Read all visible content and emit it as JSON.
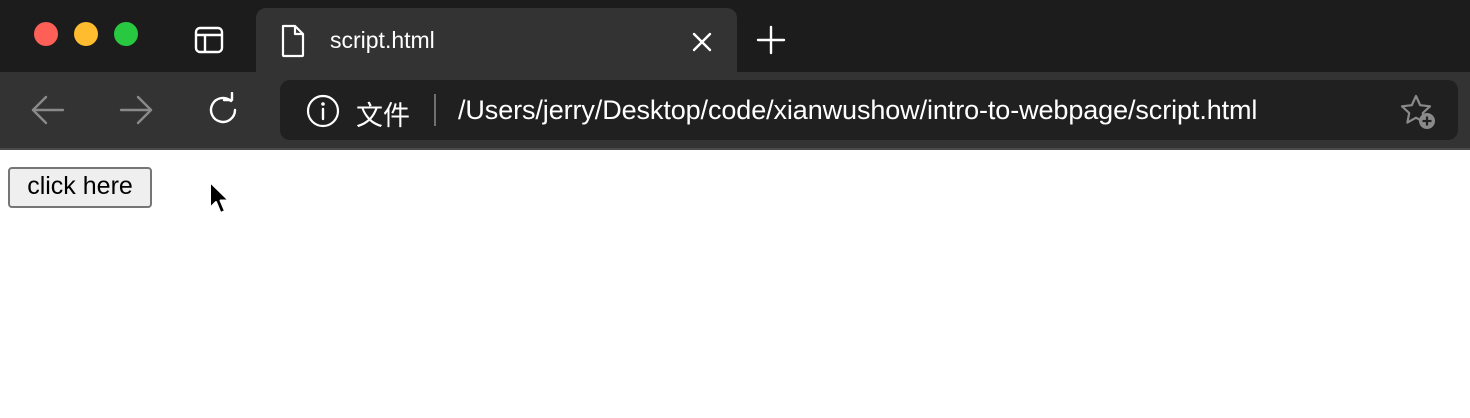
{
  "window": {
    "traffic_lights": {
      "close": {
        "icon": "close-dot",
        "color": "#fe5f57"
      },
      "minimize": {
        "icon": "minimize-dot",
        "color": "#febc2e"
      },
      "maximize": {
        "icon": "maximize-dot",
        "color": "#28c840"
      }
    },
    "tab_actions_icon": "tab-actions-icon"
  },
  "tabs": [
    {
      "title": "script.html",
      "icon": "document-icon",
      "active": true
    }
  ],
  "toolbar": {
    "back_icon": "arrow-left-icon",
    "forward_icon": "arrow-right-icon",
    "reload_icon": "reload-icon",
    "address": {
      "info_icon": "info-icon",
      "scheme_label": "文件",
      "url": "/Users/jerry/Desktop/code/xianwushow/intro-to-webpage/script.html",
      "favorite_icon": "star-add-icon"
    }
  },
  "page": {
    "button_label": "click here"
  },
  "colors": {
    "tabstrip_bg": "#1c1c1c",
    "toolbar_bg": "#333333",
    "omnibox_bg": "#202020",
    "page_bg": "#ffffff"
  }
}
